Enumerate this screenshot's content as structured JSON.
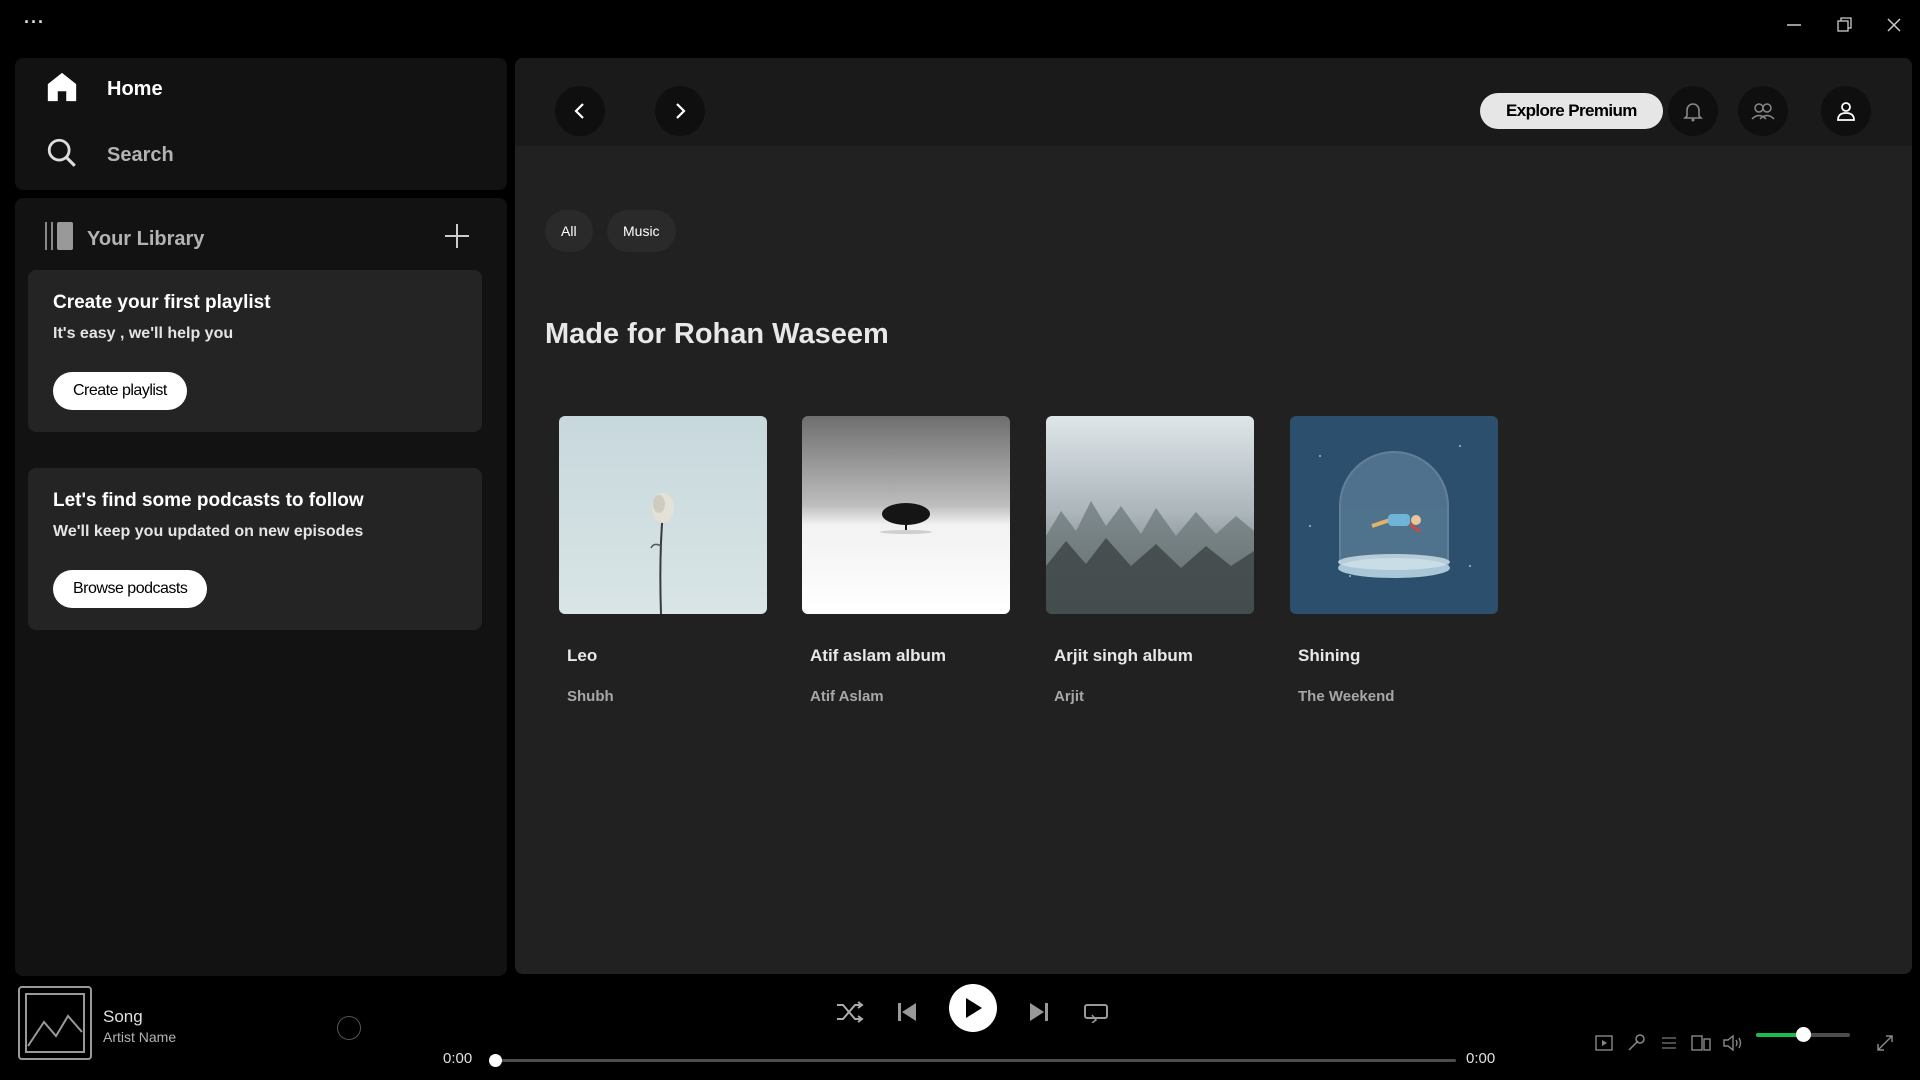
{
  "titlebar": {
    "menu_icon": "more-dots-icon",
    "controls": [
      "minimize-icon",
      "restore-icon",
      "close-icon"
    ]
  },
  "nav": {
    "home_label": "Home",
    "search_label": "Search"
  },
  "library": {
    "title": "Your Library",
    "add_icon": "plus-icon",
    "playlist_card": {
      "title": "Create your first playlist",
      "subtitle": "It's easy , we'll help you",
      "button": "Create playlist"
    },
    "podcast_card": {
      "title": "Let's find some podcasts to follow",
      "subtitle": "We'll keep you updated on new episodes",
      "button": "Browse podcasts"
    }
  },
  "header": {
    "explore_premium": "Explore Premium",
    "icons": [
      "back-arrow-icon",
      "forward-arrow-icon",
      "bell-icon",
      "friends-icon",
      "user-icon"
    ]
  },
  "filters": [
    "All",
    "Music"
  ],
  "section_title": "Made for Rohan Waseem",
  "cards": [
    {
      "title": "Leo",
      "subtitle": "Shubh"
    },
    {
      "title": "Atif aslam album",
      "subtitle": "Atif Aslam"
    },
    {
      "title": "Arjit singh album",
      "subtitle": "Arjit"
    },
    {
      "title": "Shining",
      "subtitle": "The Weekend"
    }
  ],
  "player": {
    "song": "Song",
    "artist": "Artist Name",
    "time_current": "0:00",
    "time_total": "0:00",
    "progress": 0,
    "volume": 0.5,
    "accent_color": "#1db954"
  }
}
